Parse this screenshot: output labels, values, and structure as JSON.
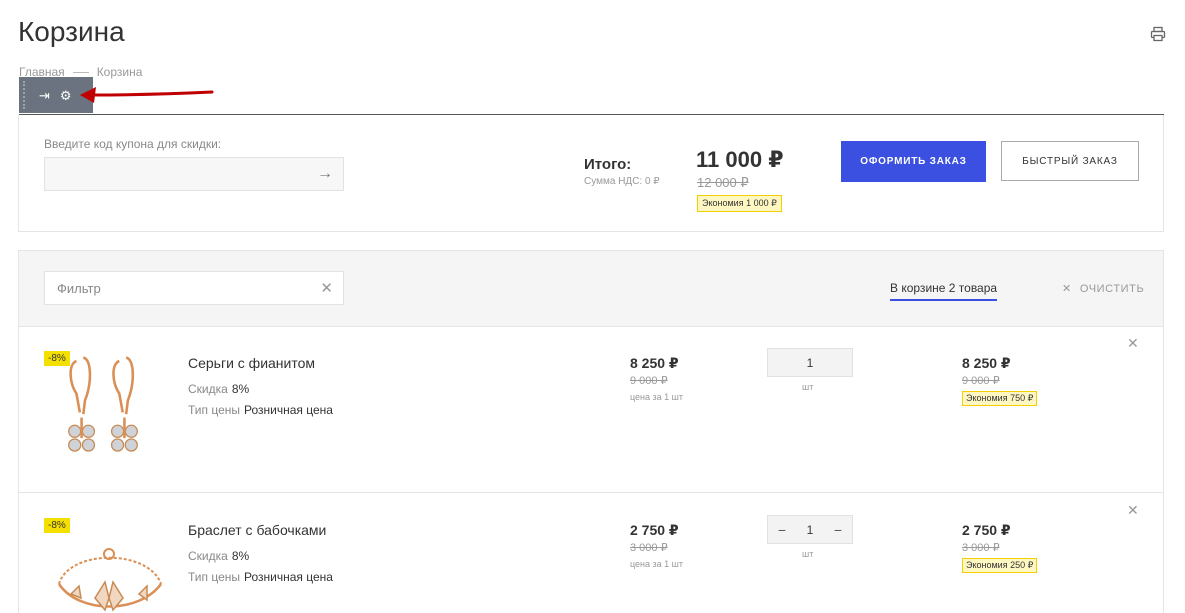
{
  "page": {
    "title": "Корзина"
  },
  "breadcrumb": {
    "items": [
      "Главная",
      "Корзина"
    ]
  },
  "admin_toolbar": {
    "icons": [
      "pin-icon",
      "gear-icon"
    ]
  },
  "coupon": {
    "label": "Введите код купона для скидки:",
    "placeholder": ""
  },
  "summary": {
    "total_label": "Итого:",
    "vat_label": "Сумма НДС: 0 ₽",
    "total_price": "11 000 ₽",
    "old_price": "12 000 ₽",
    "economy": "Экономия 1 000 ₽"
  },
  "buttons": {
    "checkout": "ОФОРМИТЬ ЗАКАЗ",
    "quick_order": "БЫСТРЫЙ ЗАКАЗ"
  },
  "cart": {
    "filter_placeholder": "Фильтр",
    "tab_label": "В корзине 2 товара",
    "clear_label": "ОЧИСТИТЬ",
    "items": [
      {
        "badge": "-8%",
        "name": "Серьги с фианитом",
        "discount_label": "Скидка",
        "discount_value": "8%",
        "price_type_label": "Тип цены",
        "price_type_value": "Розничная цена",
        "price": "8 250 ₽",
        "old_price": "9 000 ₽",
        "price_caption": "цена за 1 шт",
        "qty": "1",
        "qty_unit": "шт",
        "sum": "8 250 ₽",
        "sum_old": "9 000 ₽",
        "economy": "Экономия 750 ₽"
      },
      {
        "badge": "-8%",
        "name": "Браслет с бабочками",
        "discount_label": "Скидка",
        "discount_value": "8%",
        "price_type_label": "Тип цены",
        "price_type_value": "Розничная цена",
        "price": "2 750 ₽",
        "old_price": "3 000 ₽",
        "price_caption": "цена за 1 шт",
        "qty": "1",
        "qty_unit": "шт",
        "sum": "2 750 ₽",
        "sum_old": "3 000 ₽",
        "economy": "Экономия 250 ₽"
      }
    ]
  },
  "colors": {
    "accent": "#3b4fe0",
    "badge": "#f4e000",
    "economy_border": "#f2cf00",
    "annotation_arrow": "#c00000"
  }
}
